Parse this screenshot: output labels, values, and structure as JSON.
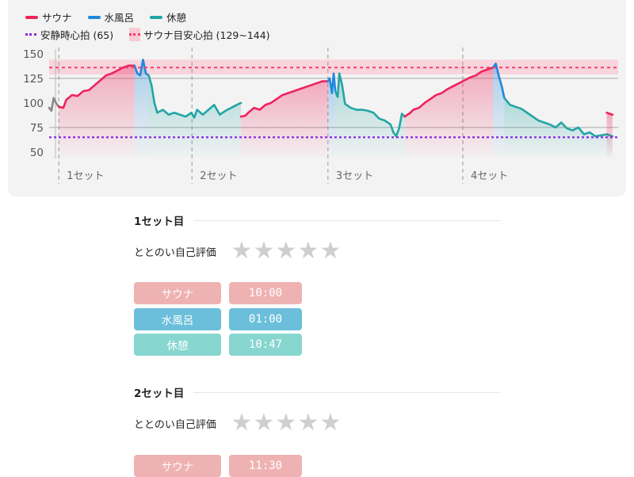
{
  "legend": {
    "sauna": "サウナ",
    "cold_bath": "水風呂",
    "rest": "休憩",
    "resting_hr": "安静時心拍 (65)",
    "target_hr": "サウナ目安心拍 (129~144)"
  },
  "colors": {
    "sauna": "#f0225c",
    "cold_bath": "#1f88dc",
    "rest": "#23a5a5",
    "resting_hr": "#8a2be2",
    "target_band": "#f9c9d4",
    "target_line": "#f0406b",
    "other": "#888888",
    "pill_sauna": "#efb2b3",
    "pill_cold": "#6bbfdb",
    "pill_rest": "#87d6cf"
  },
  "chart_data": {
    "type": "line",
    "ylim": [
      45,
      158
    ],
    "y_ticks": [
      50,
      75,
      100,
      125,
      150
    ],
    "x_range": [
      0,
      100
    ],
    "resting_hr": 65,
    "target_range": [
      129,
      144
    ],
    "target_line": 136,
    "grid_lines": [
      75,
      125
    ],
    "set_markers": [
      {
        "x": 1.7,
        "label": "1セット"
      },
      {
        "x": 25.1,
        "label": "2セット"
      },
      {
        "x": 49.0,
        "label": "3セット"
      },
      {
        "x": 72.7,
        "label": "4セット"
      }
    ],
    "segments": [
      {
        "phase": "other",
        "points": [
          [
            0,
            95
          ],
          [
            0.4,
            92
          ],
          [
            0.8,
            105
          ],
          [
            1.2,
            100
          ],
          [
            1.7,
            96
          ]
        ]
      },
      {
        "phase": "sauna",
        "points": [
          [
            1.7,
            96
          ],
          [
            2.5,
            95
          ],
          [
            3,
            103
          ],
          [
            4,
            108
          ],
          [
            5,
            107
          ],
          [
            6,
            112
          ],
          [
            7,
            113
          ],
          [
            8,
            118
          ],
          [
            9,
            123
          ],
          [
            10,
            128
          ],
          [
            11,
            130
          ],
          [
            12,
            133
          ],
          [
            13,
            136
          ],
          [
            14,
            138
          ],
          [
            15,
            138
          ]
        ]
      },
      {
        "phase": "cold",
        "points": [
          [
            15,
            138
          ],
          [
            15.5,
            130
          ],
          [
            16,
            128
          ],
          [
            16.5,
            144
          ],
          [
            17,
            130
          ],
          [
            17.5,
            128
          ]
        ]
      },
      {
        "phase": "rest",
        "points": [
          [
            17.5,
            128
          ],
          [
            18,
            118
          ],
          [
            18.5,
            100
          ],
          [
            19,
            90
          ],
          [
            20,
            93
          ],
          [
            21,
            88
          ],
          [
            22,
            90
          ],
          [
            23,
            88
          ],
          [
            24,
            86
          ],
          [
            25,
            90
          ],
          [
            25.5,
            85
          ],
          [
            26,
            93
          ],
          [
            27,
            88
          ],
          [
            28,
            93
          ],
          [
            29,
            98
          ],
          [
            30,
            88
          ],
          [
            31,
            92
          ],
          [
            32,
            95
          ],
          [
            33,
            98
          ],
          [
            33.7,
            100
          ]
        ]
      },
      {
        "phase": "sauna",
        "points": [
          [
            33.7,
            86
          ],
          [
            34.5,
            87
          ],
          [
            35,
            90
          ],
          [
            36,
            95
          ],
          [
            37,
            93
          ],
          [
            38,
            98
          ],
          [
            39,
            100
          ],
          [
            40,
            104
          ],
          [
            41,
            108
          ],
          [
            42,
            110
          ],
          [
            43,
            112
          ],
          [
            44,
            114
          ],
          [
            45,
            116
          ],
          [
            46,
            118
          ],
          [
            47,
            120
          ],
          [
            48,
            122
          ],
          [
            49,
            122
          ]
        ]
      },
      {
        "phase": "cold",
        "points": [
          [
            49,
            122
          ],
          [
            49.3,
            125
          ],
          [
            49.7,
            110
          ],
          [
            50,
            130
          ],
          [
            50.3,
            112
          ]
        ]
      },
      {
        "phase": "rest",
        "points": [
          [
            50.3,
            112
          ],
          [
            50.7,
            106
          ],
          [
            51,
            130
          ],
          [
            51.5,
            118
          ],
          [
            52,
            99
          ],
          [
            53,
            95
          ],
          [
            54,
            93
          ],
          [
            55,
            93
          ],
          [
            56,
            92
          ],
          [
            57,
            90
          ],
          [
            58,
            84
          ],
          [
            59,
            82
          ],
          [
            60,
            78
          ],
          [
            60.5,
            70
          ],
          [
            61,
            66
          ],
          [
            61.5,
            74
          ],
          [
            62,
            89
          ],
          [
            62.5,
            86
          ]
        ]
      },
      {
        "phase": "sauna",
        "points": [
          [
            62.5,
            86
          ],
          [
            63,
            88
          ],
          [
            63.5,
            90
          ],
          [
            64,
            93
          ],
          [
            65,
            95
          ],
          [
            66,
            100
          ],
          [
            67,
            104
          ],
          [
            68,
            108
          ],
          [
            69,
            110
          ],
          [
            70,
            114
          ],
          [
            71,
            117
          ],
          [
            72,
            120
          ],
          [
            73,
            123
          ],
          [
            74,
            126
          ],
          [
            75,
            128
          ],
          [
            76,
            132
          ],
          [
            77,
            134
          ],
          [
            78,
            136
          ]
        ]
      },
      {
        "phase": "cold",
        "points": [
          [
            78,
            136
          ],
          [
            78.5,
            140
          ],
          [
            79,
            128
          ],
          [
            79.5,
            118
          ],
          [
            80,
            105
          ]
        ]
      },
      {
        "phase": "rest",
        "points": [
          [
            80,
            105
          ],
          [
            81,
            98
          ],
          [
            82,
            96
          ],
          [
            83,
            94
          ],
          [
            84,
            90
          ],
          [
            85,
            86
          ],
          [
            86,
            82
          ],
          [
            87,
            80
          ],
          [
            88,
            78
          ],
          [
            89,
            75
          ],
          [
            90,
            80
          ],
          [
            91,
            74
          ],
          [
            92,
            72
          ],
          [
            93,
            75
          ],
          [
            94,
            68
          ],
          [
            95,
            70
          ],
          [
            96,
            66
          ],
          [
            97,
            67
          ],
          [
            98,
            68
          ],
          [
            99,
            66
          ]
        ]
      },
      {
        "phase": "sauna",
        "points": [
          [
            98,
            90
          ],
          [
            99,
            88
          ]
        ]
      }
    ]
  },
  "sets": [
    {
      "title": "1セット目",
      "rating_label": "ととのい自己評価",
      "rating": 0,
      "rows": [
        {
          "label": "サウナ",
          "value": "10:00"
        },
        {
          "label": "水風呂",
          "value": "01:00"
        },
        {
          "label": "休憩",
          "value": "10:47"
        }
      ]
    },
    {
      "title": "2セット目",
      "rating_label": "ととのい自己評価",
      "rating": 0,
      "rows": [
        {
          "label": "サウナ",
          "value": "11:30"
        }
      ]
    }
  ],
  "star_glyph": "★"
}
